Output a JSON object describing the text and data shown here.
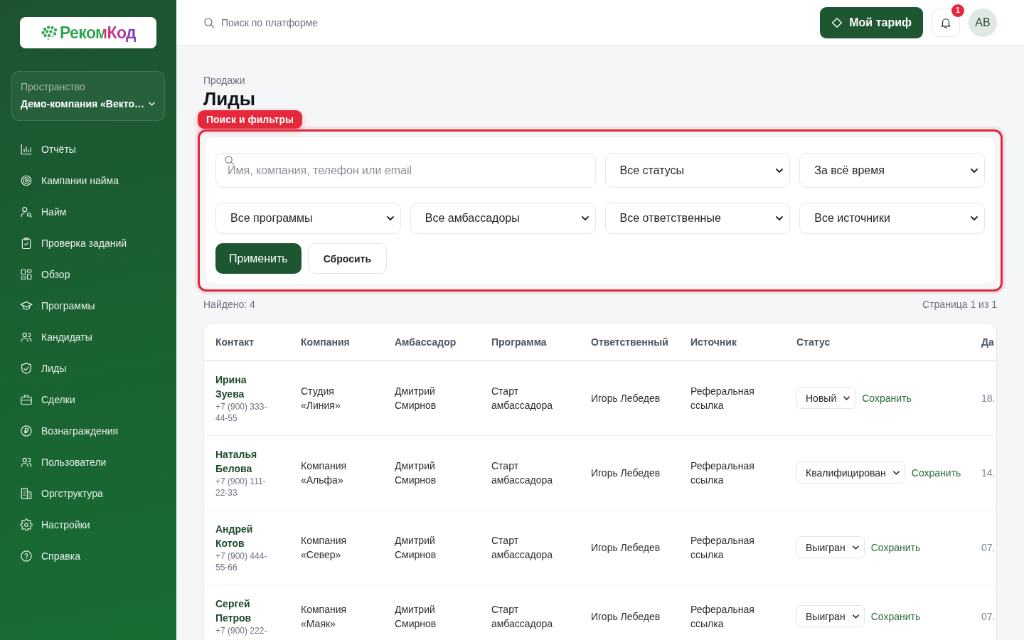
{
  "sidebar": {
    "logo": {
      "text": "РекомКод"
    },
    "workspace": {
      "label": "Пространство",
      "value": "Демо-компания «Векто…"
    },
    "items": [
      {
        "label": "Отчёты"
      },
      {
        "label": "Кампании найма"
      },
      {
        "label": "Найм"
      },
      {
        "label": "Проверка заданий"
      },
      {
        "label": "Обзор"
      },
      {
        "label": "Программы"
      },
      {
        "label": "Кандидаты"
      },
      {
        "label": "Лиды"
      },
      {
        "label": "Сделки"
      },
      {
        "label": "Вознаграждения"
      },
      {
        "label": "Пользователи"
      },
      {
        "label": "Оргструктура"
      },
      {
        "label": "Настройки"
      },
      {
        "label": "Справка"
      }
    ]
  },
  "topbar": {
    "search": {
      "placeholder": "Поиск по платформе"
    },
    "plan_button": "Мой тариф",
    "notifications": {
      "badge": "1"
    },
    "avatar": "AB"
  },
  "page": {
    "breadcrumb": "Продажи",
    "title": "Лиды"
  },
  "filters": {
    "callout": "Поиск и фильтры",
    "search": {
      "placeholder": "Имя, компания, телефон или email"
    },
    "selects": [
      {
        "value": "Все статусы"
      },
      {
        "value": "За всё время"
      },
      {
        "value": "Все программы"
      },
      {
        "value": "Все амбассадоры"
      },
      {
        "value": "Все ответственные"
      },
      {
        "value": "Все источники"
      }
    ],
    "buttons": [
      {
        "label": "Применить",
        "kind": "primary"
      },
      {
        "label": "Сбросить",
        "kind": "secondary"
      }
    ]
  },
  "summary": {
    "found": "Найдено: 4",
    "pagination": "Страница 1 из 1"
  },
  "table": {
    "columns": [
      "Контакт",
      "Компания",
      "Амбассадор",
      "Программа",
      "Ответственный",
      "Источник",
      "Статус",
      "Да"
    ],
    "rows": [
      {
        "name": "Ирина Зуева",
        "phone": "+7 (900) 333-44-55",
        "company": "Студия «Линия»",
        "ambassador": "Дмитрий Смирнов",
        "program": "Старт амбассадора",
        "responsible": "Игорь Лебедев",
        "source": "Реферальная ссылка",
        "status": "Новый",
        "action": "Сохранить",
        "column_8": "18."
      },
      {
        "name": "Наталья Белова",
        "phone": "+7 (900) 111-22-33",
        "company": "Компания «Альфа»",
        "ambassador": "Дмитрий Смирнов",
        "program": "Старт амбассадора",
        "responsible": "Игорь Лебедев",
        "source": "Реферальная ссылка",
        "status": "Квалифицирован",
        "action": "Сохранить",
        "column_8": "14."
      },
      {
        "name": "Андрей Котов",
        "phone": "+7 (900) 444-55-66",
        "company": "Компания «Север»",
        "ambassador": "Дмитрий Смирнов",
        "program": "Старт амбассадора",
        "responsible": "Игорь Лебедев",
        "source": "Реферальная ссылка",
        "status": "Выигран",
        "action": "Сохранить",
        "column_8": "07."
      },
      {
        "name": "Сергей Петров",
        "phone": "+7 (900) 222-",
        "company": "Компания «Маяк»",
        "ambassador": "Дмитрий Смирнов",
        "program": "Старт амбассадора",
        "responsible": "Игорь Лебедев",
        "source": "Реферальная ссылка",
        "status": "Выигран",
        "action": "Сохранить",
        "column_8": "07."
      }
    ]
  }
}
